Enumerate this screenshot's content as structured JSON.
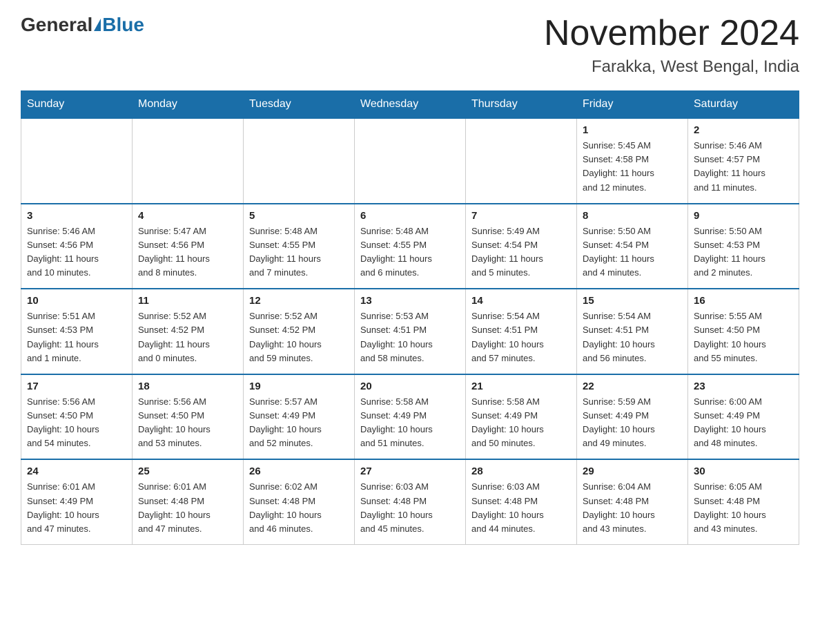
{
  "header": {
    "logo_general": "General",
    "logo_blue": "Blue",
    "month_title": "November 2024",
    "location": "Farakka, West Bengal, India"
  },
  "weekdays": [
    "Sunday",
    "Monday",
    "Tuesday",
    "Wednesday",
    "Thursday",
    "Friday",
    "Saturday"
  ],
  "weeks": [
    [
      {
        "day": "",
        "info": ""
      },
      {
        "day": "",
        "info": ""
      },
      {
        "day": "",
        "info": ""
      },
      {
        "day": "",
        "info": ""
      },
      {
        "day": "",
        "info": ""
      },
      {
        "day": "1",
        "info": "Sunrise: 5:45 AM\nSunset: 4:58 PM\nDaylight: 11 hours\nand 12 minutes."
      },
      {
        "day": "2",
        "info": "Sunrise: 5:46 AM\nSunset: 4:57 PM\nDaylight: 11 hours\nand 11 minutes."
      }
    ],
    [
      {
        "day": "3",
        "info": "Sunrise: 5:46 AM\nSunset: 4:56 PM\nDaylight: 11 hours\nand 10 minutes."
      },
      {
        "day": "4",
        "info": "Sunrise: 5:47 AM\nSunset: 4:56 PM\nDaylight: 11 hours\nand 8 minutes."
      },
      {
        "day": "5",
        "info": "Sunrise: 5:48 AM\nSunset: 4:55 PM\nDaylight: 11 hours\nand 7 minutes."
      },
      {
        "day": "6",
        "info": "Sunrise: 5:48 AM\nSunset: 4:55 PM\nDaylight: 11 hours\nand 6 minutes."
      },
      {
        "day": "7",
        "info": "Sunrise: 5:49 AM\nSunset: 4:54 PM\nDaylight: 11 hours\nand 5 minutes."
      },
      {
        "day": "8",
        "info": "Sunrise: 5:50 AM\nSunset: 4:54 PM\nDaylight: 11 hours\nand 4 minutes."
      },
      {
        "day": "9",
        "info": "Sunrise: 5:50 AM\nSunset: 4:53 PM\nDaylight: 11 hours\nand 2 minutes."
      }
    ],
    [
      {
        "day": "10",
        "info": "Sunrise: 5:51 AM\nSunset: 4:53 PM\nDaylight: 11 hours\nand 1 minute."
      },
      {
        "day": "11",
        "info": "Sunrise: 5:52 AM\nSunset: 4:52 PM\nDaylight: 11 hours\nand 0 minutes."
      },
      {
        "day": "12",
        "info": "Sunrise: 5:52 AM\nSunset: 4:52 PM\nDaylight: 10 hours\nand 59 minutes."
      },
      {
        "day": "13",
        "info": "Sunrise: 5:53 AM\nSunset: 4:51 PM\nDaylight: 10 hours\nand 58 minutes."
      },
      {
        "day": "14",
        "info": "Sunrise: 5:54 AM\nSunset: 4:51 PM\nDaylight: 10 hours\nand 57 minutes."
      },
      {
        "day": "15",
        "info": "Sunrise: 5:54 AM\nSunset: 4:51 PM\nDaylight: 10 hours\nand 56 minutes."
      },
      {
        "day": "16",
        "info": "Sunrise: 5:55 AM\nSunset: 4:50 PM\nDaylight: 10 hours\nand 55 minutes."
      }
    ],
    [
      {
        "day": "17",
        "info": "Sunrise: 5:56 AM\nSunset: 4:50 PM\nDaylight: 10 hours\nand 54 minutes."
      },
      {
        "day": "18",
        "info": "Sunrise: 5:56 AM\nSunset: 4:50 PM\nDaylight: 10 hours\nand 53 minutes."
      },
      {
        "day": "19",
        "info": "Sunrise: 5:57 AM\nSunset: 4:49 PM\nDaylight: 10 hours\nand 52 minutes."
      },
      {
        "day": "20",
        "info": "Sunrise: 5:58 AM\nSunset: 4:49 PM\nDaylight: 10 hours\nand 51 minutes."
      },
      {
        "day": "21",
        "info": "Sunrise: 5:58 AM\nSunset: 4:49 PM\nDaylight: 10 hours\nand 50 minutes."
      },
      {
        "day": "22",
        "info": "Sunrise: 5:59 AM\nSunset: 4:49 PM\nDaylight: 10 hours\nand 49 minutes."
      },
      {
        "day": "23",
        "info": "Sunrise: 6:00 AM\nSunset: 4:49 PM\nDaylight: 10 hours\nand 48 minutes."
      }
    ],
    [
      {
        "day": "24",
        "info": "Sunrise: 6:01 AM\nSunset: 4:49 PM\nDaylight: 10 hours\nand 47 minutes."
      },
      {
        "day": "25",
        "info": "Sunrise: 6:01 AM\nSunset: 4:48 PM\nDaylight: 10 hours\nand 47 minutes."
      },
      {
        "day": "26",
        "info": "Sunrise: 6:02 AM\nSunset: 4:48 PM\nDaylight: 10 hours\nand 46 minutes."
      },
      {
        "day": "27",
        "info": "Sunrise: 6:03 AM\nSunset: 4:48 PM\nDaylight: 10 hours\nand 45 minutes."
      },
      {
        "day": "28",
        "info": "Sunrise: 6:03 AM\nSunset: 4:48 PM\nDaylight: 10 hours\nand 44 minutes."
      },
      {
        "day": "29",
        "info": "Sunrise: 6:04 AM\nSunset: 4:48 PM\nDaylight: 10 hours\nand 43 minutes."
      },
      {
        "day": "30",
        "info": "Sunrise: 6:05 AM\nSunset: 4:48 PM\nDaylight: 10 hours\nand 43 minutes."
      }
    ]
  ]
}
